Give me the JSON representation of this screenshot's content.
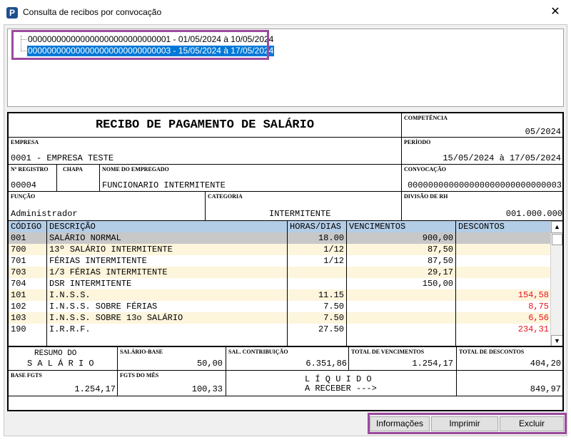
{
  "window": {
    "title": "Consulta de recibos por convocação",
    "icon": "P",
    "close": "✕"
  },
  "tree": {
    "items": [
      {
        "label": "000000000000000000000000000001 - 01/05/2024 à 10/05/2024",
        "selected": false
      },
      {
        "label": "000000000000000000000000000003 - 15/05/2024 à 17/05/2024",
        "selected": true
      }
    ]
  },
  "receipt": {
    "title": "RECIBO DE PAGAMENTO DE SALÁRIO",
    "competencia_label": "COMPETÊNCIA",
    "competencia": "05/2024",
    "empresa_label": "EMPRESA",
    "empresa": "0001 - EMPRESA TESTE",
    "periodo_label": "PERÍODO",
    "periodo": "15/05/2024 à 17/05/2024",
    "registro_label": "Nº REGISTRO",
    "registro": "00004",
    "chapa_label": "CHAPA",
    "chapa": "",
    "empregado_label": "NOME DO EMPREGADO",
    "empregado": "FUNCIONARIO INTERMITENTE",
    "convocacao_label": "CONVOCAÇÃO",
    "convocacao": "000000000000000000000000000003",
    "funcao_label": "FUNÇÃO",
    "funcao": "Administrador",
    "categoria_label": "CATEGORIA",
    "categoria": "INTERMITENTE",
    "divisao_label": "DIVISÃO DE RH",
    "divisao": "001.000.000"
  },
  "grid": {
    "headers": {
      "codigo": "CÓDIGO",
      "descricao": "DESCRIÇÃO",
      "horas": "HORAS/DIAS",
      "vencimentos": "VENCIMENTOS",
      "descontos": "DESCONTOS"
    },
    "rows": [
      {
        "codigo": "001",
        "descricao": "SALÁRIO NORMAL",
        "horas": "18.00",
        "vencimentos": "900,00",
        "descontos": ""
      },
      {
        "codigo": "700",
        "descricao": "13º SALÁRIO INTERMITENTE",
        "horas": "1/12",
        "vencimentos": "87,50",
        "descontos": ""
      },
      {
        "codigo": "701",
        "descricao": "FÉRIAS INTERMITENTE",
        "horas": "1/12",
        "vencimentos": "87,50",
        "descontos": ""
      },
      {
        "codigo": "703",
        "descricao": "1/3 FÉRIAS INTERMITENTE",
        "horas": "",
        "vencimentos": "29,17",
        "descontos": ""
      },
      {
        "codigo": "704",
        "descricao": "DSR INTERMITENTE",
        "horas": "",
        "vencimentos": "150,00",
        "descontos": ""
      },
      {
        "codigo": "101",
        "descricao": "I.N.S.S.",
        "horas": "11.15",
        "vencimentos": "",
        "descontos": "154,58"
      },
      {
        "codigo": "102",
        "descricao": "I.N.S.S. SOBRE FÉRIAS",
        "horas": "7.50",
        "vencimentos": "",
        "descontos": "8,75"
      },
      {
        "codigo": "103",
        "descricao": "I.N.S.S. SOBRE 13o SALÁRIO",
        "horas": "7.50",
        "vencimentos": "",
        "descontos": "6,56"
      },
      {
        "codigo": "190",
        "descricao": "I.R.R.F.",
        "horas": "27.50",
        "vencimentos": "",
        "descontos": "234,31"
      }
    ],
    "colors": {
      "selected_row": "#c8c8c8",
      "alt_row": "#fdf5dc",
      "header": "#b3cde6",
      "discount": "#e8141e"
    }
  },
  "summary": {
    "resumo_line1": "RESUMO DO",
    "resumo_line2": "S A L Á R I O",
    "salario_base_label": "SALÁRIO-BASE",
    "salario_base": "50,00",
    "sal_contrib_label": "SAL. CONTRIBUIÇÃO",
    "sal_contrib": "6.351,86",
    "total_venc_label": "TOTAL DE VENCIMENTOS",
    "total_venc": "1.254,17",
    "total_desc_label": "TOTAL DE DESCONTOS",
    "total_desc": "404,20",
    "base_fgts_label": "BASE FGTS",
    "base_fgts": "1.254,17",
    "fgts_mes_label": "FGTS DO MÊS",
    "fgts_mes": "100,33",
    "liquido_line1": "L Í Q U I D O",
    "liquido_line2": "A RECEBER --->",
    "liquido": "849,97"
  },
  "buttons": {
    "info": "Informações",
    "print": "Imprimir",
    "delete": "Excluir"
  },
  "accent": "#9b4a9e"
}
